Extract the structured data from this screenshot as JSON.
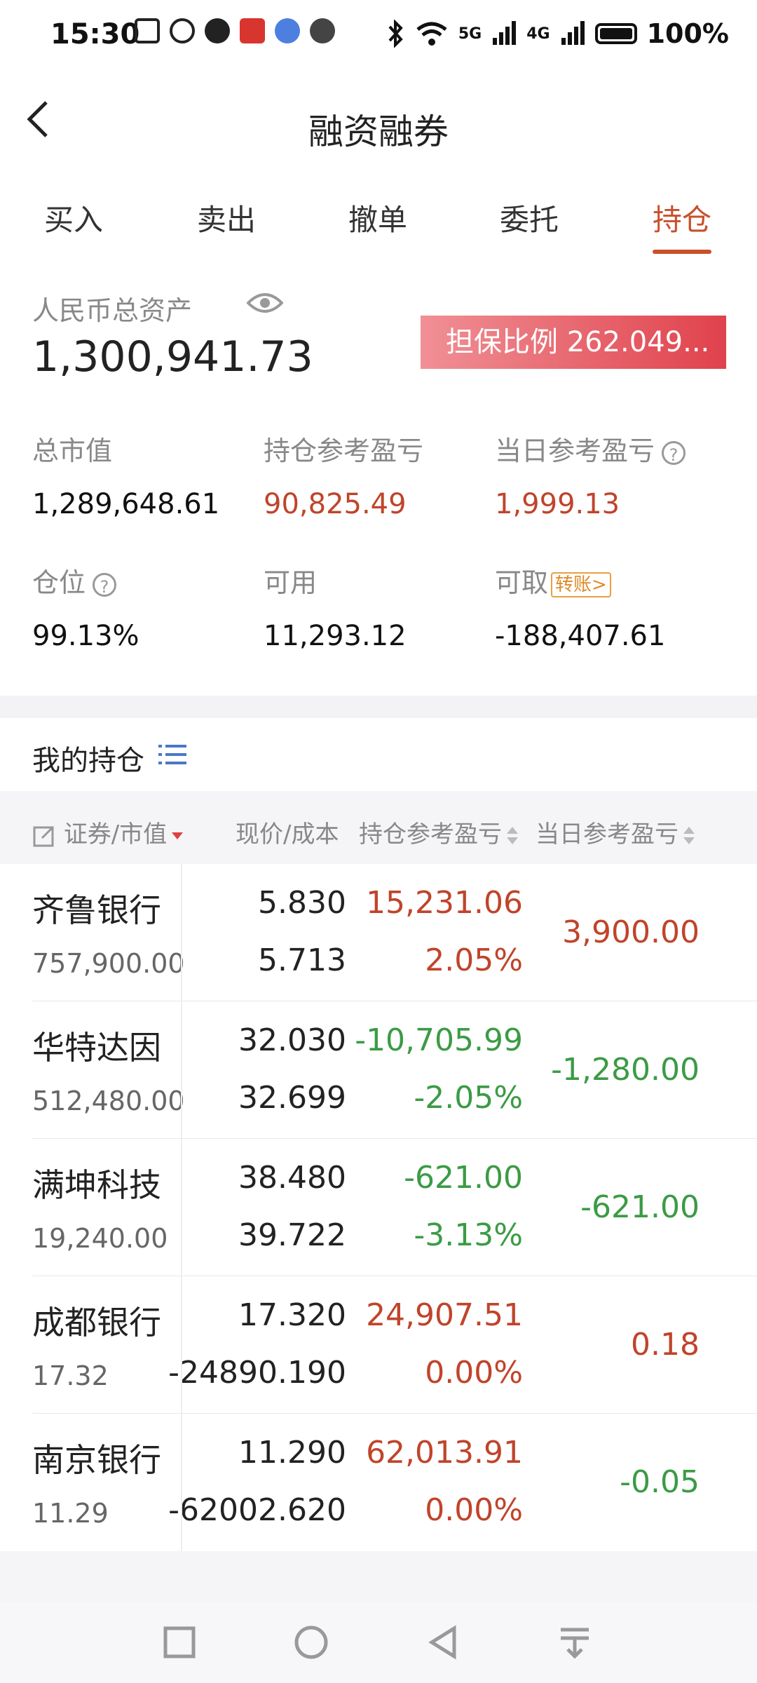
{
  "status_bar": {
    "time": "15:30",
    "battery": "100%",
    "network": [
      "5G",
      "4G"
    ]
  },
  "header": {
    "title": "融资融券"
  },
  "tabs": [
    {
      "label": "买入"
    },
    {
      "label": "卖出"
    },
    {
      "label": "撤单"
    },
    {
      "label": "委托"
    },
    {
      "label": "持仓",
      "active": true
    }
  ],
  "assets": {
    "total_label": "人民币总资产",
    "total_value": "1,300,941.73",
    "ratio_label": "担保比例 262.049...",
    "market_value_label": "总市值",
    "market_value": "1,289,648.61",
    "holding_pl_label": "持仓参考盈亏",
    "holding_pl": "90,825.49",
    "day_pl_label": "当日参考盈亏",
    "day_pl": "1,999.13",
    "position_label": "仓位",
    "position": "99.13%",
    "available_label": "可用",
    "available": "11,293.12",
    "withdrawable_label": "可取",
    "transfer_label": "转账>",
    "withdrawable": "-188,407.61"
  },
  "holdings": {
    "title": "我的持仓",
    "columns": [
      "证券/市值",
      "现价/成本",
      "持仓参考盈亏",
      "当日参考盈亏"
    ],
    "rows": [
      {
        "name": "齐鲁银行",
        "market_value": "757,900.00",
        "price": "5.830",
        "cost": "5.713",
        "pl": "15,231.06",
        "pl_pct": "2.05%",
        "day_pl": "3,900.00",
        "pl_color": "red",
        "day_color": "red"
      },
      {
        "name": "华特达因",
        "market_value": "512,480.00",
        "price": "32.030",
        "cost": "32.699",
        "pl": "-10,705.99",
        "pl_pct": "-2.05%",
        "day_pl": "-1,280.00",
        "pl_color": "green",
        "day_color": "green"
      },
      {
        "name": "满坤科技",
        "market_value": "19,240.00",
        "price": "38.480",
        "cost": "39.722",
        "pl": "-621.00",
        "pl_pct": "-3.13%",
        "day_pl": "-621.00",
        "pl_color": "green",
        "day_color": "green"
      },
      {
        "name": "成都银行",
        "market_value": "17.32",
        "price": "17.320",
        "cost": "-24890.190",
        "pl": "24,907.51",
        "pl_pct": "0.00%",
        "day_pl": "0.18",
        "pl_color": "red",
        "day_color": "red"
      },
      {
        "name": "南京银行",
        "market_value": "11.29",
        "price": "11.290",
        "cost": "-62002.620",
        "pl": "62,013.91",
        "pl_pct": "0.00%",
        "day_pl": "-0.05",
        "pl_color": "red",
        "day_color": "green"
      }
    ]
  },
  "colors": {
    "accent": "#c8502d",
    "up": "#c0442a",
    "down": "#3b9b45"
  }
}
